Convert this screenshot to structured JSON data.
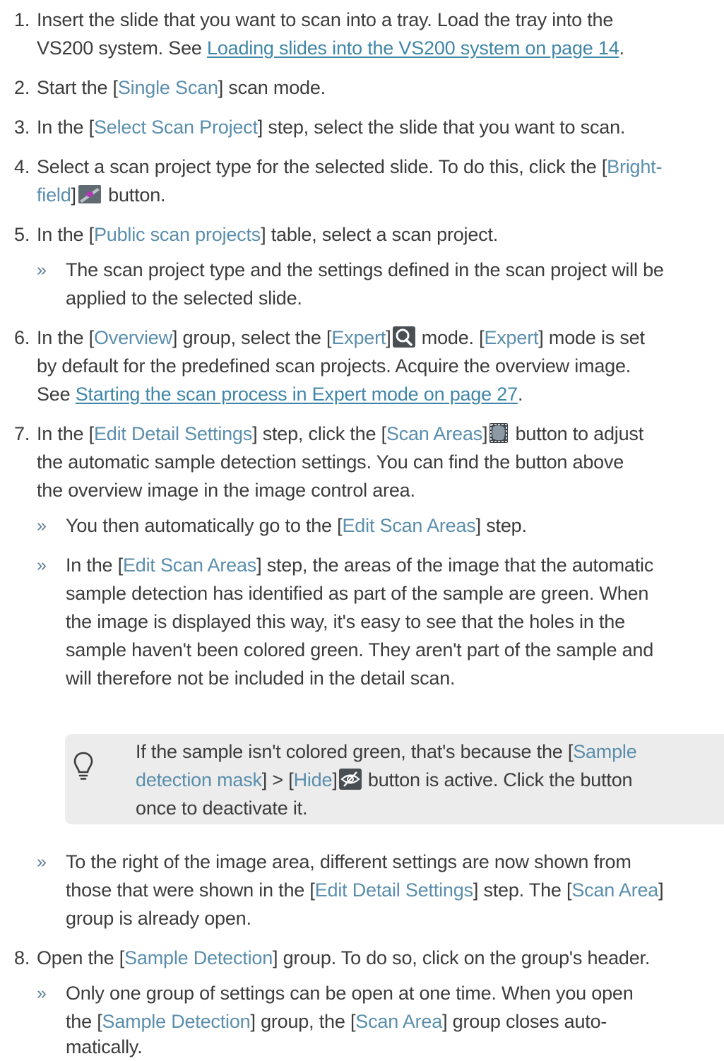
{
  "steps": {
    "s1": {
      "num": "1.",
      "l1": "Insert the slide that you want to scan into a tray. Load the tray into the",
      "l2a": "VS200 system. See ",
      "l2link": "Loading slides into the VS200 system on page 14",
      "l2b": "."
    },
    "s2": {
      "num": "2.",
      "a": "Start the [",
      "ui": "Single Scan",
      "b": "] scan mode."
    },
    "s3": {
      "num": "3.",
      "a": "In the [",
      "ui": "Select Scan Project",
      "b": "] step, select the slide that you want to scan."
    },
    "s4": {
      "num": "4.",
      "l1a": "Select a scan project type for the selected slide. To do this, click the [",
      "l1ui": "Bright-",
      "l2ui": "field",
      "l2b": "]",
      "l2c": " button."
    },
    "s5": {
      "num": "5.",
      "a": "In the [",
      "ui": "Public scan projects",
      "b": "] table, select a scan project.",
      "r1": "The scan project type and the settings defined in the scan project will be",
      "r2": "applied to the selected slide."
    },
    "s6": {
      "num": "6.",
      "l1a": "In the [",
      "l1ui1": "Overview",
      "l1b": "] group, select the [",
      "l1ui2": "Expert",
      "l1c": "]",
      "l1d": " mode. [",
      "l1ui3": "Expert",
      "l1e": "] mode is set",
      "l2": "by default for the predefined scan projects. Acquire the overview image.",
      "l3a": "See ",
      "l3link": "Starting the scan process in Expert mode on page 27",
      "l3b": "."
    },
    "s7": {
      "num": "7.",
      "l1a": "In the [",
      "l1ui1": "Edit Detail Settings",
      "l1b": "] step, click the [",
      "l1ui2": "Scan Areas",
      "l1c": "]",
      "l1d": " button to adjust",
      "l2": "the automatic sample detection settings. You can find the button above",
      "l3": "the overview image in the image control area.",
      "r1a": "You then automatically go to the [",
      "r1ui": "Edit Scan Areas",
      "r1b": "] step.",
      "r2a": "In the [",
      "r2ui": "Edit Scan Areas",
      "r2b": "] step, the areas of the image that the automatic",
      "r2l2": "sample detection has identified as part of the sample are green. When",
      "r2l3": "the image is displayed this way, it's easy to see that the holes in the",
      "r2l4": "sample haven't been colored green. They aren't part of the sample and",
      "r2l5": "will therefore not be included in the detail scan.",
      "tip": {
        "l1a": "If the sample isn't colored green, that's because the [",
        "l1ui": "Sample",
        "l2ui1": "detection mask",
        "l2a": "] > [",
        "l2ui2": "Hide",
        "l2b": "]",
        "l2c": " button is active. Click the button",
        "l3": "once to deactivate it."
      },
      "r3l1": "To the right of the image area, different settings are now shown from",
      "r3a": "those that were shown in the [",
      "r3ui1": "Edit Detail Settings",
      "r3b": "] step. The [",
      "r3ui2": "Scan Area",
      "r3c": "]",
      "r3l3": "group is already open."
    },
    "s8": {
      "num": "8.",
      "a": "Open the [",
      "ui": "Sample Detection",
      "b": "] group. To do so, click on the group's header.",
      "r1": "Only one group of settings can be open at one time. When you open",
      "r2a": "the [",
      "r2ui1": "Sample Detection",
      "r2b": "] group, the [",
      "r2ui2": "Scan Area",
      "r2c": "] group closes auto-",
      "r3": "matically."
    }
  },
  "arrow_glyph": "»",
  "icons": [
    "brightfield-slide-icon",
    "expert-magnifier-icon",
    "scan-areas-icon",
    "hide-eye-icon",
    "lightbulb-icon"
  ],
  "colors": {
    "text": "#3c3c3c",
    "ui": "#5a8eac",
    "link": "#3f86a8",
    "tip_bg": "#ececec"
  }
}
